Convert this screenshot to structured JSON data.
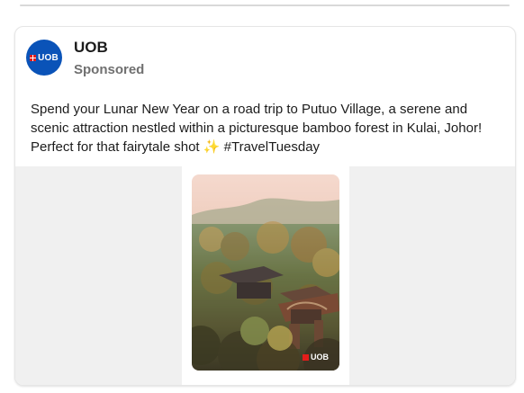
{
  "post": {
    "author": "UOB",
    "sponsored_label": "Sponsored",
    "avatar_text": "UOB",
    "text_main": "Spend your Lunar New Year on a road trip to Putuo Village, a serene and scenic attraction nestled within a picturesque bamboo forest in Kulai, Johor! Perfect for that fairytale shot",
    "text_emoji": "✨",
    "hashtag": "#TravelTuesday",
    "image_watermark": "UOB"
  },
  "colors": {
    "brand_blue": "#0a53b8",
    "brand_red": "#e31d1a",
    "text_primary": "#1c1c1c",
    "text_secondary": "#707070",
    "media_bg": "#f0f0f0"
  },
  "icons": {
    "avatar": "uob-logo-icon",
    "emoji": "sparkles-icon",
    "watermark": "uob-logo-icon"
  }
}
